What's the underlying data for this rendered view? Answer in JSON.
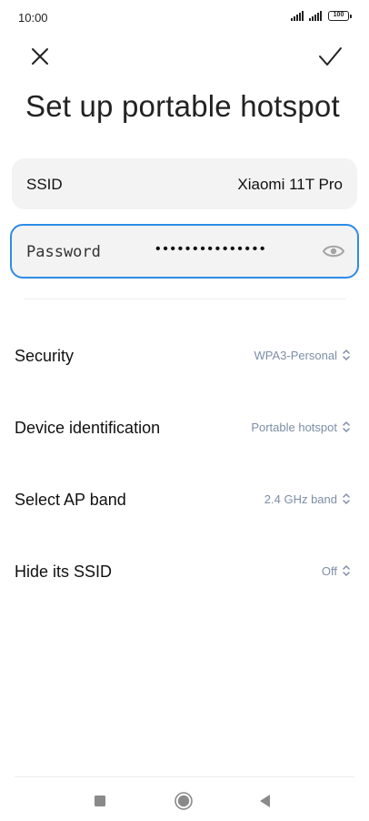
{
  "status_bar": {
    "time": "10:00",
    "battery": "100"
  },
  "toolbar": {
    "close_icon": "close-icon",
    "confirm_icon": "checkmark-icon"
  },
  "page": {
    "title": "Set up portable hotspot"
  },
  "ssid": {
    "label": "SSID",
    "value": "Xiaomi 11T Pro"
  },
  "password": {
    "label": "Password",
    "value": "•••••••••••••••",
    "visibility_icon": "eye-icon"
  },
  "settings": [
    {
      "label": "Security",
      "value": "WPA3-Personal"
    },
    {
      "label": "Device identification",
      "value": "Portable hotspot"
    },
    {
      "label": "Select AP band",
      "value": "2.4 GHz band"
    },
    {
      "label": "Hide its SSID",
      "value": "Off"
    }
  ],
  "nav_bar": {
    "icons": [
      "recents-square-icon",
      "home-circle-icon",
      "back-triangle-icon"
    ]
  },
  "colors": {
    "accent": "#2d8ce6",
    "value_text": "#7d8ea6",
    "card_bg": "#f3f3f3"
  }
}
